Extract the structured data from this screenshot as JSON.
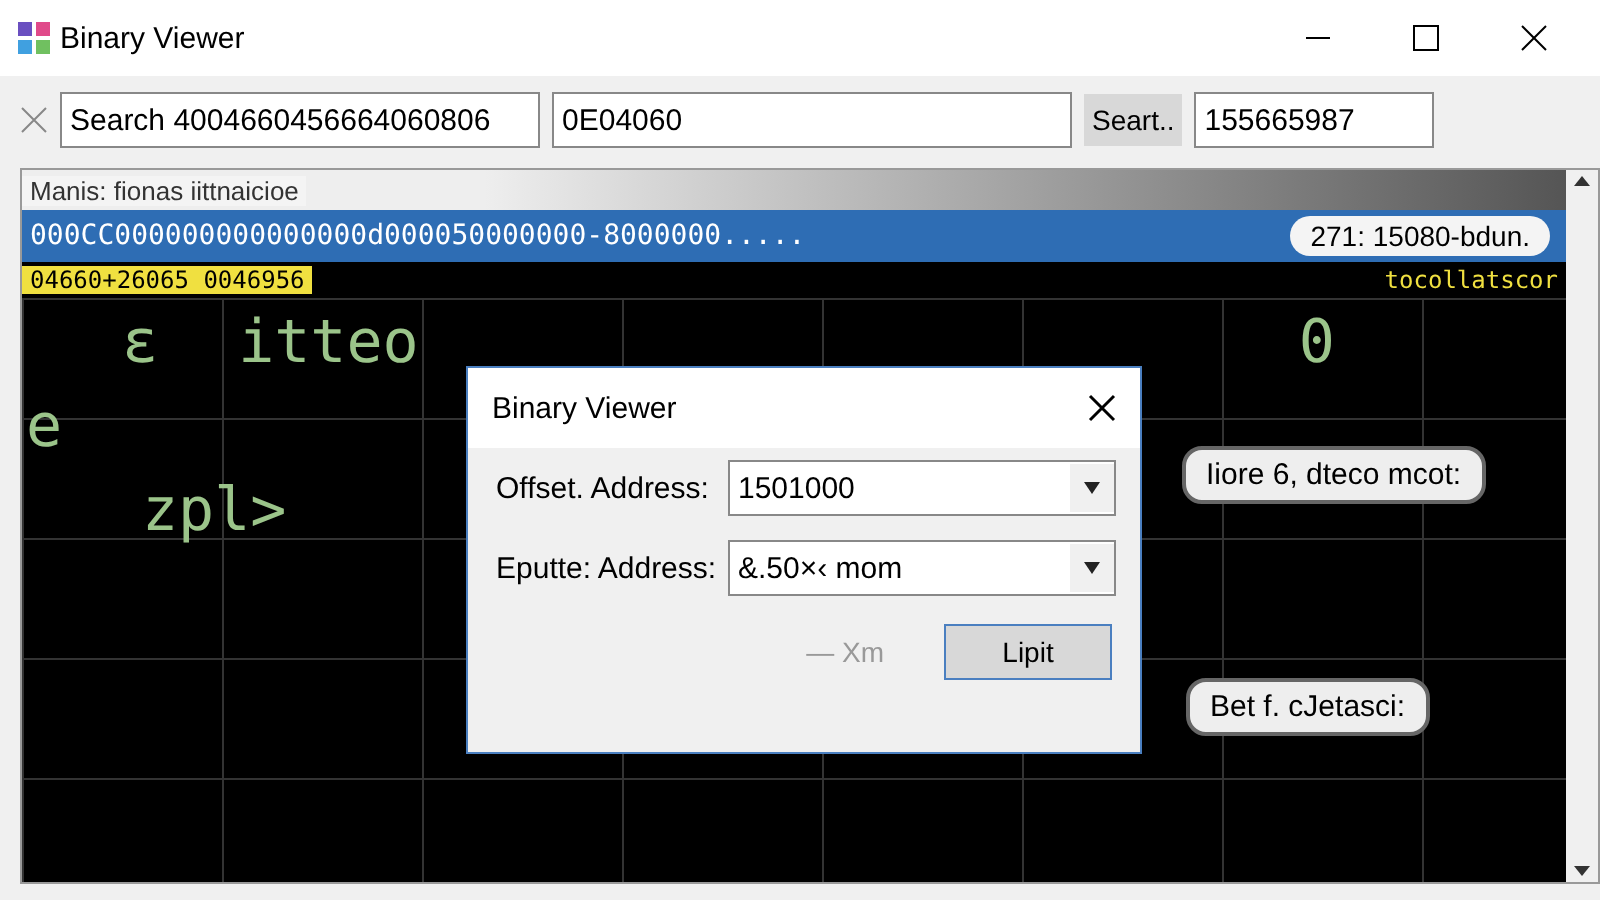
{
  "window": {
    "title": "Binary Viewer"
  },
  "toolbar": {
    "search_field": {
      "value": "Search 4004660456664060806"
    },
    "address_field": {
      "value": "0E04060"
    },
    "search_button": "Seart..",
    "result_field": {
      "value": "155665987"
    }
  },
  "panel": {
    "header": "Manis: fionas iittnaicioe",
    "rows": [
      {
        "kind": "selected",
        "cells": [
          "000CC000000000000000d000050000000-8000000.....",
          "271: 15080-bdun."
        ]
      },
      {
        "kind": "highlight",
        "cells": [
          "04660+26065  0046956",
          "tocollatscor"
        ]
      }
    ],
    "canvas_rows": [
      [
        "ɛ",
        "itteo",
        "0"
      ],
      [
        "e"
      ],
      [
        "zpl>"
      ]
    ]
  },
  "dialog": {
    "title": "Binary Viewer",
    "fields": [
      {
        "label": "Offset. Address:",
        "value": "1501000"
      },
      {
        "label": "Eputte: Address:",
        "value": "&.50×‹ mom"
      }
    ],
    "hint": "— Xm",
    "button": "Lipit"
  },
  "callouts": [
    "Iiore 6, dteco mcot:",
    "Bet f. cJetasci:"
  ]
}
